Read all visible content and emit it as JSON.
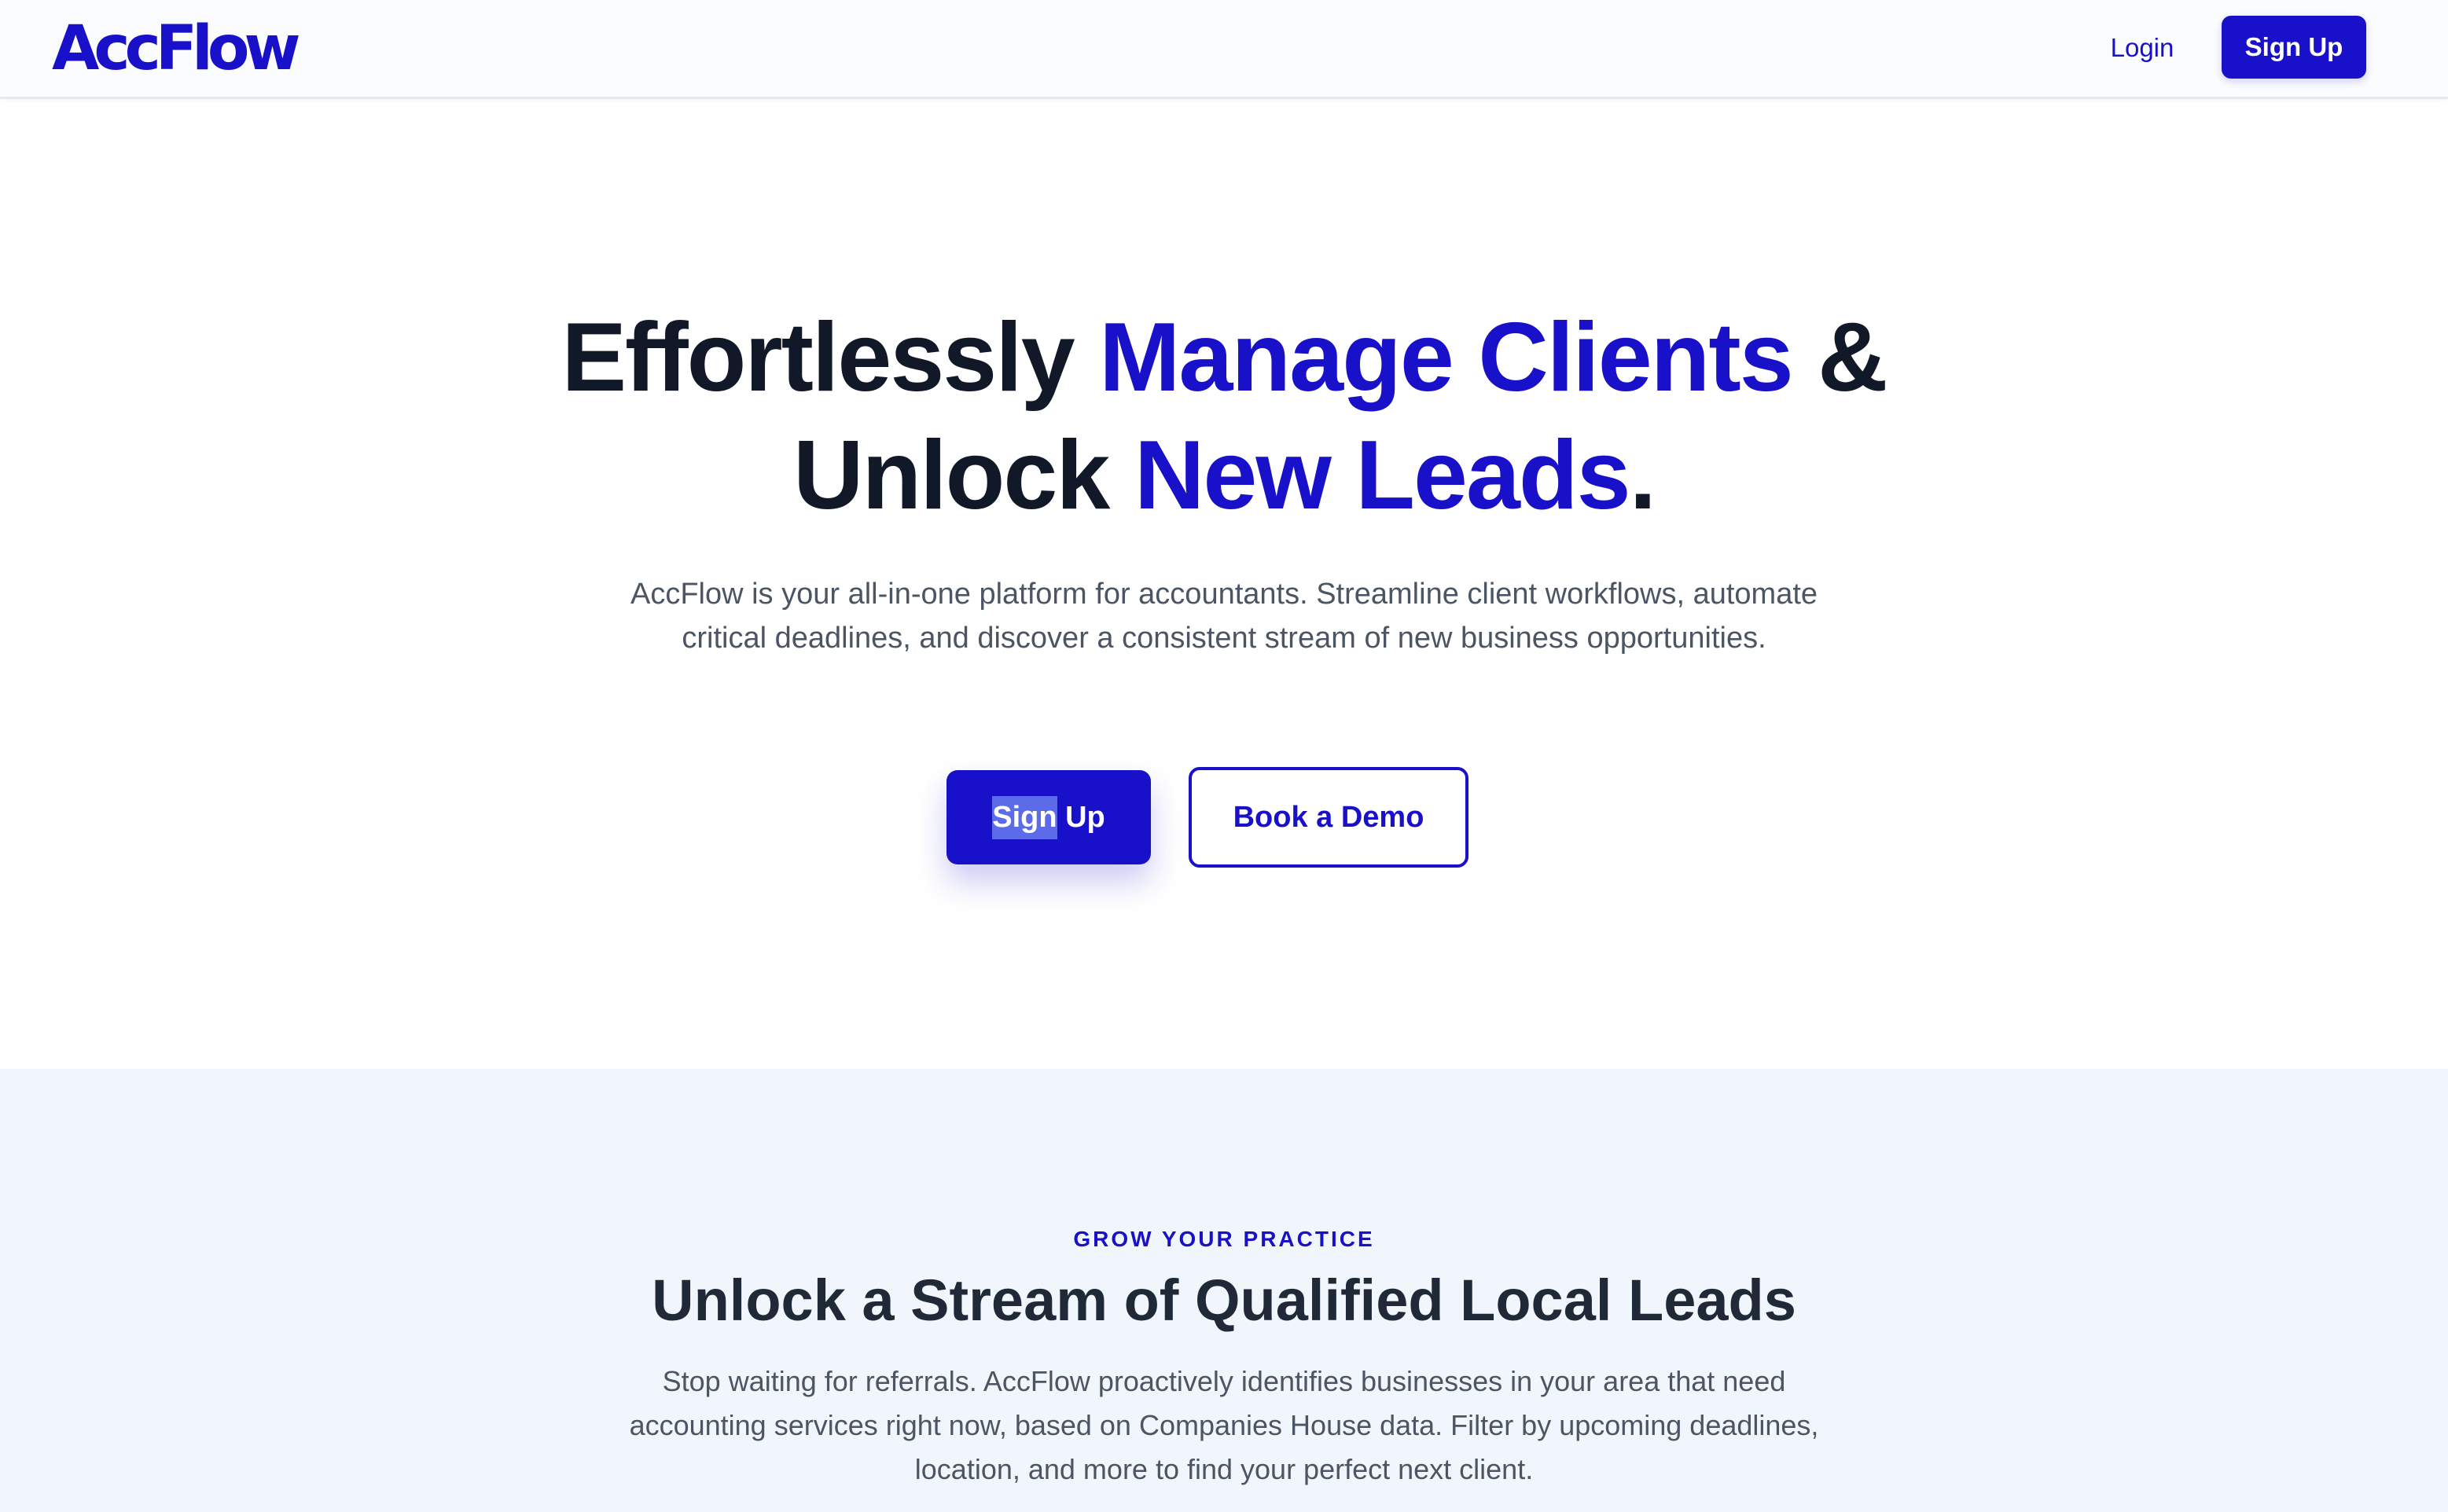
{
  "header": {
    "logo_text": "AccFlow",
    "login_label": "Login",
    "signup_label": "Sign Up"
  },
  "hero": {
    "title": {
      "part1": "Effortlessly ",
      "accent1": "Manage Clients",
      "part2": " &",
      "part3": "Unlock ",
      "accent2": "New Leads",
      "part4": "."
    },
    "subtitle": "AccFlow is your all-in-one platform for accountants. Streamline client workflows, automate critical deadlines, and discover a consistent stream of new business opportunities.",
    "cta_signup_selected": "Sign",
    "cta_signup_rest": " Up",
    "cta_demo_label": "Book a Demo"
  },
  "leads": {
    "eyebrow": "GROW YOUR PRACTICE",
    "title": "Unlock a Stream of Qualified Local Leads",
    "subtitle": "Stop waiting for referrals. AccFlow proactively identifies businesses in your area that need accounting services right now, based on Companies House data. Filter by upcoming deadlines, location, and more to find your perfect next client."
  },
  "colors": {
    "brand": "#1811c9",
    "heading": "#111827",
    "body_text": "#4b5563",
    "section_bg": "#f1f6fc"
  }
}
